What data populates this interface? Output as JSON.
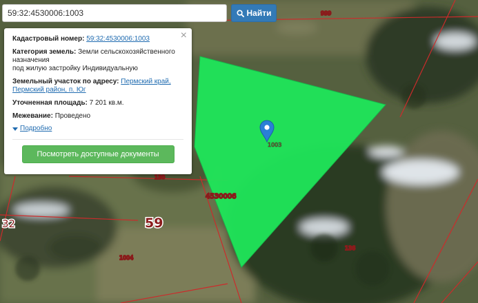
{
  "search": {
    "value": "59:32:4530006:1003",
    "button_label": "Найти",
    "button_color": "#337ab7",
    "icon": "search-icon"
  },
  "popup": {
    "close_symbol": "×",
    "cadastral_label": "Кадастровый номер:",
    "cadastral_value": "59:32:4530006:1003",
    "category_label": "Категория земель:",
    "category_value_line1": "Земли сельскохозяйственного",
    "category_value_line2": "назначения",
    "category_value_line3": "под жилую застройку Индивидуальную",
    "address_label": "Земельный участок по адресу:",
    "address_value_line1": "Пермский край,",
    "address_value_line2": "Пермский район, п. Юг",
    "area_label": "Уточненная площадь:",
    "area_value": "7 201 кв.м.",
    "survey_label": "Межевание:",
    "survey_value": "Проведено",
    "more_label": "Подробно",
    "docs_button": "Посмотреть доступные документы",
    "docs_button_color": "#5cb85c"
  },
  "map": {
    "parcel_color": "#1fe65a",
    "boundary_color": "#cc2b2b",
    "marker_icon": "map-marker-icon",
    "labels": {
      "q999": "999",
      "q136": "136",
      "q1004": "1004",
      "q59": "59",
      "q32": "32",
      "q4530006": "4530006",
      "q130": "130",
      "q1003": "1003"
    }
  }
}
